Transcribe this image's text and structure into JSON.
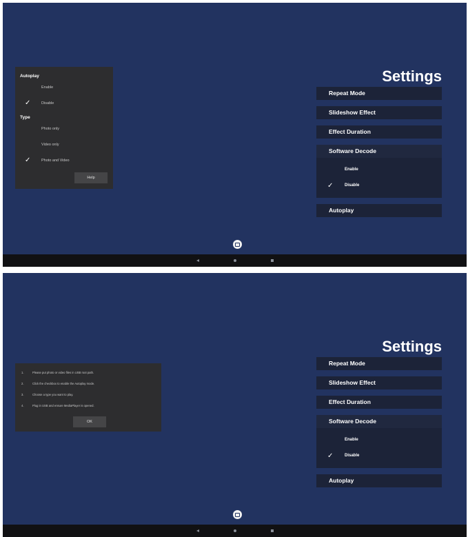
{
  "settings": {
    "title": "Settings",
    "menu": {
      "repeat_mode": "Repeat Mode",
      "slideshow_effect": "Slideshow Effect",
      "effect_duration": "Effect Duration",
      "software_decode": "Software Decode",
      "software_decode_options": [
        "Enable",
        "Disable"
      ],
      "software_decode_selected": "Disable",
      "autoplay": "Autoplay"
    }
  },
  "autoplay_dialog": {
    "autoplay_heading": "Autoplay",
    "autoplay_options": [
      "Enable",
      "Disable"
    ],
    "autoplay_selected": "Disable",
    "type_heading": "Type",
    "type_options": [
      "Photo only",
      "Video only",
      "Photo and Video"
    ],
    "type_selected": "Photo and Video",
    "help_label": "Help"
  },
  "help_dialog": {
    "steps": [
      {
        "num": "1.",
        "text": "Please put photo or video files in USB root path."
      },
      {
        "num": "2.",
        "text": "Click the checkbox to enable the Autoplay mode."
      },
      {
        "num": "3.",
        "text": "Choose a type you want to play."
      },
      {
        "num": "4.",
        "text": "Plug in USB and ensure MediaPlayer is opened."
      }
    ],
    "ok_label": "OK"
  },
  "check_glyph": "✓",
  "colors": {
    "screen_bg": "#223360",
    "menu_item_bg": "#1c2338",
    "dialog_bg": "#2d2d2f",
    "navbar_bg": "#111113"
  }
}
